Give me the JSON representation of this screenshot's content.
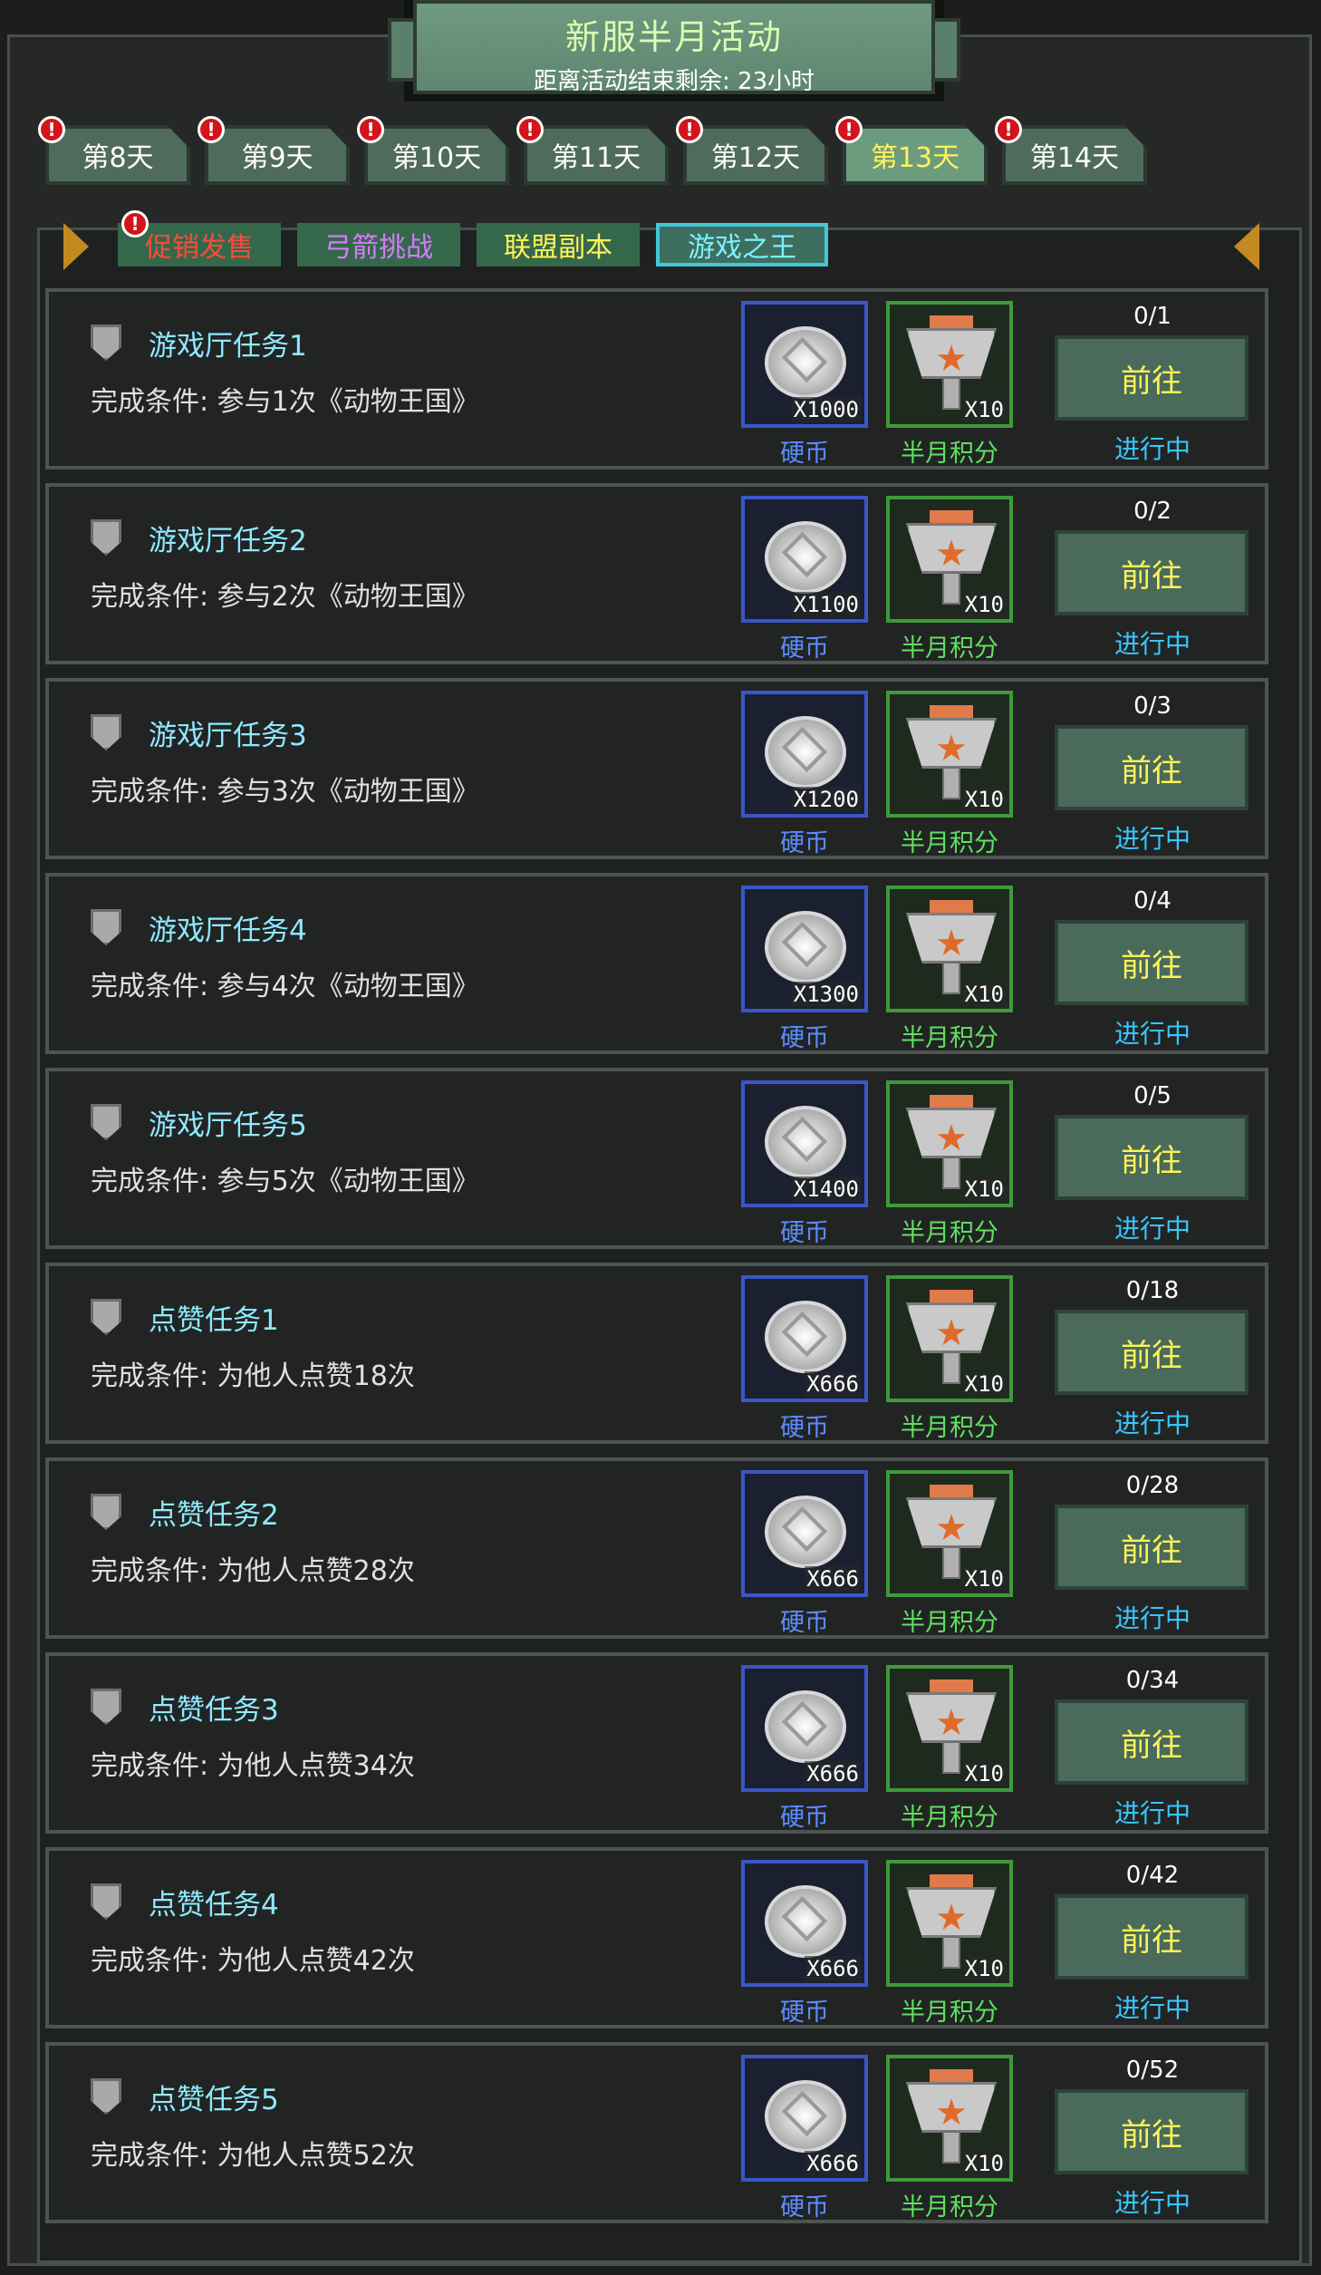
{
  "header": {
    "title": "新服半月活动",
    "subtitle": "距离活动结束剩余: 23小时"
  },
  "day_tabs": [
    {
      "label": "第8天",
      "active": false,
      "alert": "!"
    },
    {
      "label": "第9天",
      "active": false,
      "alert": "!"
    },
    {
      "label": "第10天",
      "active": false,
      "alert": "!"
    },
    {
      "label": "第11天",
      "active": false,
      "alert": "!"
    },
    {
      "label": "第12天",
      "active": false,
      "alert": "!"
    },
    {
      "label": "第13天",
      "active": true,
      "alert": "!"
    },
    {
      "label": "第14天",
      "active": false,
      "alert": "!"
    }
  ],
  "category_tabs": [
    {
      "label": "促销发售",
      "color": "#ff4a3a",
      "alert": "!",
      "active": false
    },
    {
      "label": "弓箭挑战",
      "color": "#d57bff",
      "active": false
    },
    {
      "label": "联盟副本",
      "color": "#fff35a",
      "active": false
    },
    {
      "label": "游戏之王",
      "color": "#7ef0ff",
      "active": true
    }
  ],
  "reward_labels": {
    "coin": "硬币",
    "score": "半月积分"
  },
  "button_label": "前往",
  "tasks": [
    {
      "title": "游戏厅任务1",
      "condition": "完成条件: 参与1次《动物王国》",
      "coin_qty": "X1000",
      "score_qty": "X10",
      "progress": "0/1",
      "status": "进行中"
    },
    {
      "title": "游戏厅任务2",
      "condition": "完成条件: 参与2次《动物王国》",
      "coin_qty": "X1100",
      "score_qty": "X10",
      "progress": "0/2",
      "status": "进行中"
    },
    {
      "title": "游戏厅任务3",
      "condition": "完成条件: 参与3次《动物王国》",
      "coin_qty": "X1200",
      "score_qty": "X10",
      "progress": "0/3",
      "status": "进行中"
    },
    {
      "title": "游戏厅任务4",
      "condition": "完成条件: 参与4次《动物王国》",
      "coin_qty": "X1300",
      "score_qty": "X10",
      "progress": "0/4",
      "status": "进行中"
    },
    {
      "title": "游戏厅任务5",
      "condition": "完成条件: 参与5次《动物王国》",
      "coin_qty": "X1400",
      "score_qty": "X10",
      "progress": "0/5",
      "status": "进行中"
    },
    {
      "title": "点赞任务1",
      "condition": "完成条件: 为他人点赞18次",
      "coin_qty": "X666",
      "score_qty": "X10",
      "progress": "0/18",
      "status": "进行中"
    },
    {
      "title": "点赞任务2",
      "condition": "完成条件: 为他人点赞28次",
      "coin_qty": "X666",
      "score_qty": "X10",
      "progress": "0/28",
      "status": "进行中"
    },
    {
      "title": "点赞任务3",
      "condition": "完成条件: 为他人点赞34次",
      "coin_qty": "X666",
      "score_qty": "X10",
      "progress": "0/34",
      "status": "进行中"
    },
    {
      "title": "点赞任务4",
      "condition": "完成条件: 为他人点赞42次",
      "coin_qty": "X666",
      "score_qty": "X10",
      "progress": "0/42",
      "status": "进行中"
    },
    {
      "title": "点赞任务5",
      "condition": "完成条件: 为他人点赞52次",
      "coin_qty": "X666",
      "score_qty": "X10",
      "progress": "0/52",
      "status": "进行中"
    }
  ]
}
